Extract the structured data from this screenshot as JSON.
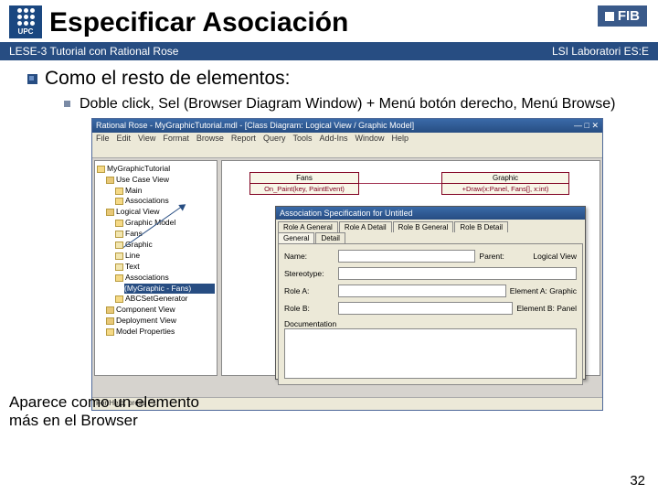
{
  "header": {
    "upc": "UPC",
    "title": "Especificar Asociación",
    "fib": "FIB"
  },
  "subbar": {
    "left": "LESE-3 Tutorial con Rational Rose",
    "right": "LSI Laboratori ES:E"
  },
  "bullets": {
    "main": "Como el resto de elementos:",
    "sub": "Doble click, Sel (Browser Diagram Window) + Menú botón derecho, Menú Browse)"
  },
  "app": {
    "title": "Rational Rose - MyGraphicTutorial.mdl - [Class Diagram: Logical View / Graphic Model]",
    "menu": [
      "File",
      "Edit",
      "View",
      "Format",
      "Browse",
      "Report",
      "Query",
      "Tools",
      "Add-Ins",
      "Window",
      "Help"
    ],
    "status": "For Help, press F1"
  },
  "tree": {
    "i0": "MyGraphicTutorial",
    "i1": "Use Case View",
    "i2": "Main",
    "i3": "Associations",
    "i4": "Logical View",
    "i5": "Graphic Model",
    "i6": "Fans",
    "i7": "Graphic",
    "i8": "Line",
    "i9": "Text",
    "i10": "Associations",
    "i11": "(MyGraphic - Fans)",
    "i12": "ABCSetGenerator",
    "i13": "Component View",
    "i14": "Deployment View",
    "i15": "Model Properties"
  },
  "classes": {
    "fans": "Fans",
    "fans_body": "On_Paint(key, PaintEvent)",
    "graphic": "Graphic",
    "graphic_body": "+Draw(x:Panel, Fans[], x:int)"
  },
  "dialog": {
    "title": "Association Specification for Untitled",
    "tabs": [
      "General",
      "Detail",
      "Role A General",
      "Role B General",
      "Role A Detail",
      "Role B Detail"
    ],
    "labels": {
      "name": "Name:",
      "parent": "Parent:",
      "parent_val": "Logical View",
      "stereo": "Stereotype:",
      "rolea": "Role A:",
      "rolea_el": "Element A: Graphic",
      "roleb": "Role B:",
      "roleb_el": "Element B: Panel",
      "doc": "Documentation"
    }
  },
  "callout": "Aparece como un elemento más en el Browser",
  "pagenum": "32"
}
